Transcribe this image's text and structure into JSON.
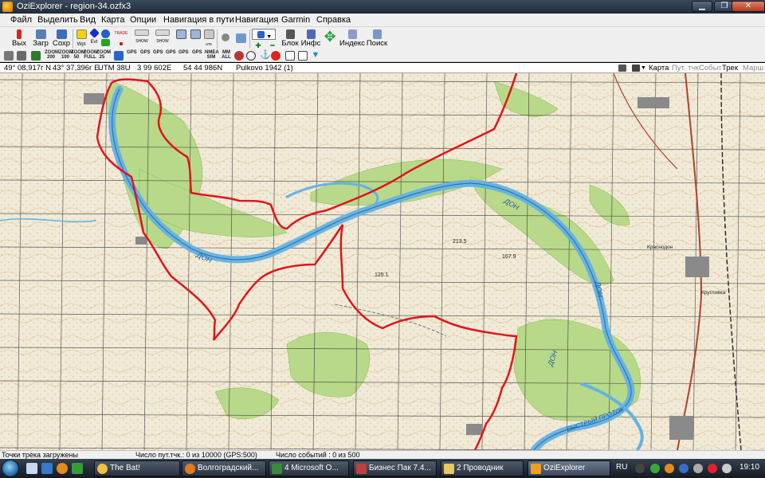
{
  "window": {
    "title": "OziExplorer - region-34.ozfx3"
  },
  "menu": [
    "Файл",
    "Выделить",
    "Вид",
    "Карта",
    "Опции",
    "Навигация в пути",
    "Навигация",
    "Garmin",
    "Справка"
  ],
  "toolbar1": {
    "exit": "Вых",
    "load": "Загр",
    "save": "Сохр",
    "wpt": "Wpt",
    "evt": "Evt",
    "trade": "TRADE",
    "show": "SHOW",
    "blok": "Блок",
    "info": "Инфс",
    "index": "Индекс",
    "search": "Поиск",
    "uts": "ᴜᴛs"
  },
  "toolbar2": {
    "zoom": [
      "ZOOM 200",
      "ZOOM 100",
      "ZOOM 50",
      "ZOOM FULL",
      "ZOOM 25"
    ],
    "gps": [
      "GPS",
      "GPS",
      "GPS",
      "GPS",
      "GPS",
      "GPS"
    ],
    "nmea": "NMEA SIM",
    "mm": "MM ALL"
  },
  "coords": {
    "lat": "49° 08,917г N",
    "lon": "43° 37,396г E",
    "utm": "UTM  38U",
    "easting": "3 99 602E",
    "northing": "54 44 986N",
    "datum": "Pulkovo 1942 (1)"
  },
  "tabs": {
    "map": "Карта",
    "route": "Пут. тчк",
    "events": "Событ",
    "track": "Трек",
    "march": "Марш"
  },
  "map": {
    "labels": [
      "ДОН",
      "ДОН",
      "ДОН",
      "ДОН",
      "БЫСТРЫЙ ПРОТОК",
      "213.5",
      "167.9",
      "125.1",
      "Краснодон",
      "Кругловка"
    ],
    "colors": {
      "paper": "#f1ead6",
      "forest": "#b9d98a",
      "river": "#64b2e3",
      "route": "#e2141b",
      "grid": "#2a2a2a"
    }
  },
  "status": {
    "left": "Точки трека загружены",
    "waypoints": "Число пут.тчк.: 0 из 10000  (GPS:500)",
    "events": "Число событий : 0 из 500"
  },
  "taskbar": {
    "tasks": [
      "The Bat!",
      "Волгоградский...",
      "4 Microsoft O...",
      "Бизнес Пак 7.4...",
      "2 Проводник",
      "OziExplorer"
    ],
    "lang": "RU",
    "clock": "19:10"
  }
}
